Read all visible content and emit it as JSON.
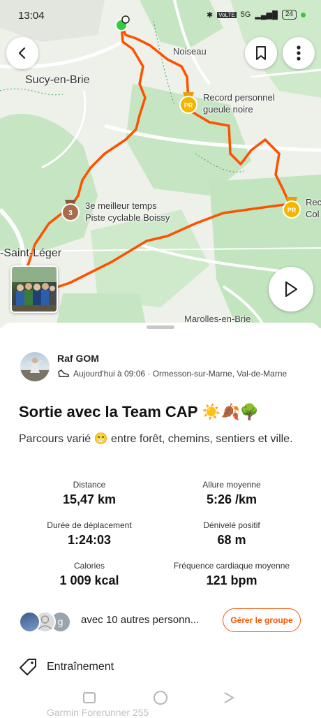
{
  "status_bar": {
    "time": "13:04",
    "battery": "24",
    "network": "5G"
  },
  "map": {
    "places": [
      "Sucy-en-Brie",
      "Noiseau",
      "-Saint-Léger",
      "Marolles-en-Brie"
    ],
    "segments": [
      {
        "line1": "Record personnel",
        "line2": "gueule noire",
        "badge": "PR"
      },
      {
        "line1": "Rec",
        "line2": "Col",
        "badge": "PR"
      },
      {
        "line1": "3e meilleur temps",
        "line2": "Piste cyclable Boissy",
        "badge": "3"
      }
    ],
    "route_color": "#fc5200"
  },
  "activity": {
    "athlete": "Raf GOM",
    "datetime_location": "Aujourd'hui à 09:06 · Ormesson-sur-Marne, Val-de-Marne",
    "title": "Sortie avec la Team CAP ☀️🍂🌳",
    "description": "Parcours varié 😁 entre forêt, chemins, sentiers et ville.",
    "stats": [
      {
        "label": "Distance",
        "value": "15,47 km"
      },
      {
        "label": "Allure moyenne",
        "value": "5:26 /km"
      },
      {
        "label": "Durée de déplacement",
        "value": "1:24:03"
      },
      {
        "label": "Dénivelé positif",
        "value": "68 m"
      },
      {
        "label": "Calories",
        "value": "1 009 kcal"
      },
      {
        "label": "Fréquence cardiaque moyenne",
        "value": "121 bpm"
      }
    ],
    "group_text": "avec 10 autres personn...",
    "group_initial": "g",
    "manage_group": "Gérer le groupe",
    "workout_type": "Entraînement",
    "device": "Garmin Forerunner 255"
  },
  "accent_color": "#fc5200"
}
